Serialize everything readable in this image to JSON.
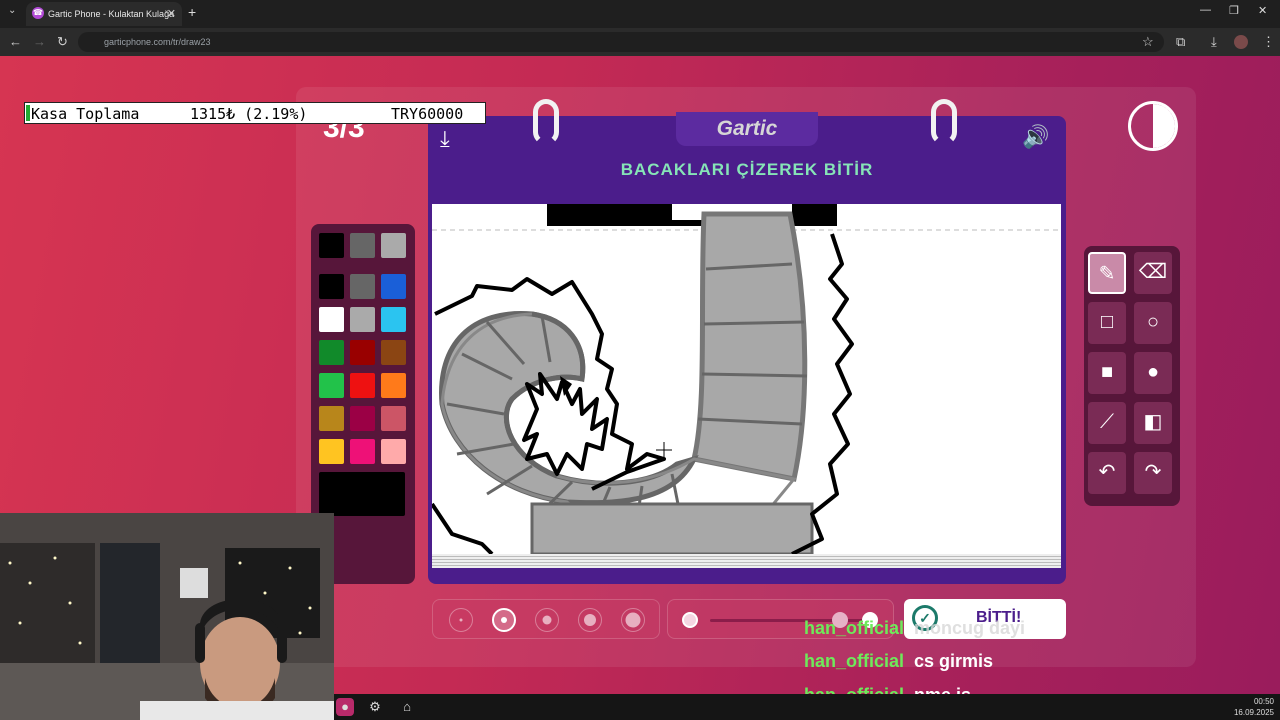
{
  "browser": {
    "tab_title": "Gartic Phone - Kulaktan Kulağa",
    "url": "garticphone.com/tr/draw23"
  },
  "ticker": {
    "label": "Kasa Toplama",
    "amount": "1315₺ (2.19%)",
    "goal": "TRY60000"
  },
  "game": {
    "round": "3/3",
    "logo": "Gartic",
    "task": "BACAKLARI ÇİZEREK BİTİR",
    "done_button": "BİTTİ!"
  },
  "palette": {
    "colors": [
      "#000000",
      "#666666",
      "#aaaaaa",
      "#000000",
      "#666666",
      "#1a5fd8",
      "#ffffff",
      "#aaaaaa",
      "#2bc4f0",
      "#118a2a",
      "#990000",
      "#8b4513",
      "#22c24a",
      "#ee1111",
      "#ff7a1a",
      "#b8861b",
      "#9b0045",
      "#cc5566",
      "#ffc421",
      "#ee1177",
      "#ffaaaa"
    ],
    "current_color": "#000000"
  },
  "tools": {
    "items": [
      "pencil-icon",
      "eraser-icon",
      "square-outline-icon",
      "circle-outline-icon",
      "square-filled-icon",
      "circle-filled-icon",
      "line-icon",
      "fill-bucket-icon",
      "undo-icon",
      "redo-icon"
    ],
    "active": "pencil-icon"
  },
  "brush": {
    "sizes": 5,
    "selected_size": 2,
    "opacity_percent": 100
  },
  "chat": [
    {
      "user": "han_official",
      "message": "moncug dayi"
    },
    {
      "user": "han_official",
      "message": "cs girmis"
    },
    {
      "user": "han_official",
      "message": "nme iş"
    }
  ],
  "taskbar": {
    "time": "00:50",
    "date": "16.09.2025"
  }
}
